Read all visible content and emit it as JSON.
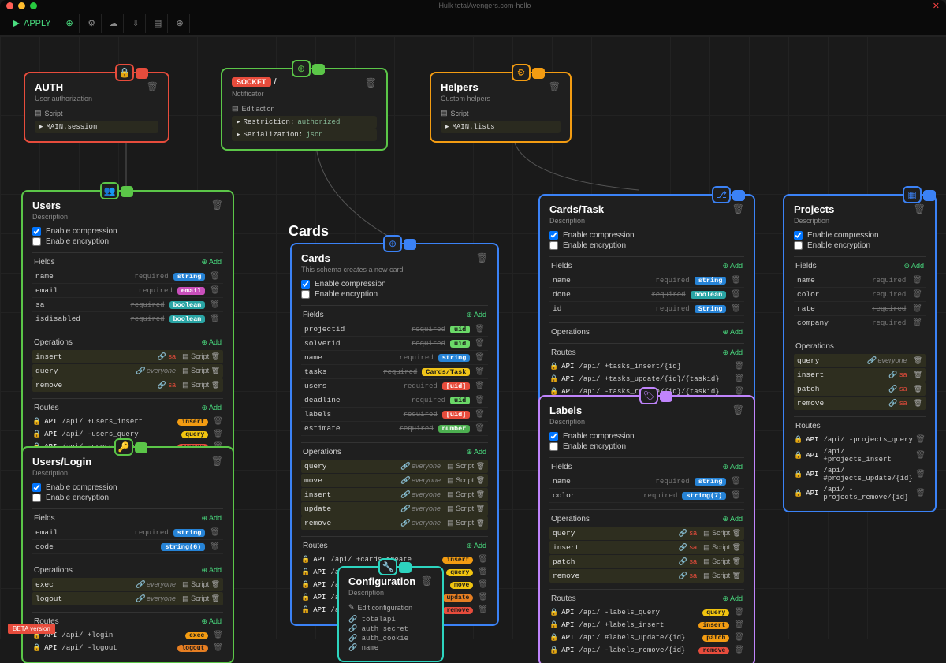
{
  "titlebar": {
    "title": "Hulk totalAvengers.com-hello"
  },
  "toolbar": {
    "apply": "APPLY"
  },
  "canvas_title": "Cards",
  "beta": "BETA version",
  "nodes": {
    "auth": {
      "title": "AUTH",
      "sub": "User authorization",
      "meta": "Script",
      "code": "MAIN.session"
    },
    "notificator": {
      "sub": "Notificator",
      "edit": "Edit action",
      "l1": "Restriction:",
      "l1v": "authorized",
      "l2": "Serialization:",
      "l2v": "json"
    },
    "helpers": {
      "title": "Helpers",
      "sub": "Custom helpers",
      "meta": "Script",
      "code": "MAIN.lists"
    },
    "users": {
      "title": "Users",
      "sub": "Description",
      "chk1": "Enable compression",
      "chk2": "Enable encryption",
      "fields_h": "Fields",
      "add": "Add",
      "fields": [
        {
          "n": "name",
          "r": "required",
          "t": "string"
        },
        {
          "n": "email",
          "r": "required",
          "t": "email"
        },
        {
          "n": "sa",
          "r": "required",
          "rs": true,
          "t": "boolean"
        },
        {
          "n": "isdisabled",
          "r": "required",
          "rs": true,
          "t": "boolean"
        }
      ],
      "ops_h": "Operations",
      "ops": [
        {
          "n": "insert",
          "m": "sa",
          "r": "Script"
        },
        {
          "n": "query",
          "m": "everyone",
          "r": "Script"
        },
        {
          "n": "remove",
          "m": "sa",
          "r": "Script"
        }
      ],
      "routes_h": "Routes",
      "routes": [
        {
          "p": "/api/ +users_insert",
          "pill": "insert"
        },
        {
          "p": "/api/ -users_query",
          "pill": "query"
        },
        {
          "p": "/api/ -users_remove",
          "pill": "remove"
        }
      ]
    },
    "users_login": {
      "title": "Users/Login",
      "sub": "Description",
      "chk1": "Enable compression",
      "chk2": "Enable encryption",
      "fields_h": "Fields",
      "add": "Add",
      "fields": [
        {
          "n": "email",
          "r": "required",
          "t": "string"
        },
        {
          "n": "code",
          "r": "",
          "t": "string(6)"
        }
      ],
      "ops_h": "Operations",
      "ops": [
        {
          "n": "exec",
          "m": "everyone",
          "r": "Script"
        },
        {
          "n": "logout",
          "m": "everyone",
          "r": "Script"
        }
      ],
      "routes_h": "Routes",
      "routes": [
        {
          "p": "/api/ +login",
          "pill": "exec"
        },
        {
          "p": "/api/ -logout",
          "pill": "logout"
        }
      ]
    },
    "cards": {
      "title": "Cards",
      "sub": "This schema creates a new card",
      "chk1": "Enable compression",
      "chk2": "Enable encryption",
      "fields_h": "Fields",
      "add": "Add",
      "fields": [
        {
          "n": "projectid",
          "r": "required",
          "rs": true,
          "t": "uid"
        },
        {
          "n": "solverid",
          "r": "required",
          "rs": true,
          "t": "uid"
        },
        {
          "n": "name",
          "r": "required",
          "t": "string"
        },
        {
          "n": "tasks",
          "r": "required",
          "rs": true,
          "t": "Cards/Task"
        },
        {
          "n": "users",
          "r": "required",
          "rs": true,
          "t": "[uid]"
        },
        {
          "n": "deadline",
          "r": "required",
          "rs": true,
          "t": "uid"
        },
        {
          "n": "labels",
          "r": "required",
          "rs": true,
          "t": "[uid]"
        },
        {
          "n": "estimate",
          "r": "required",
          "rs": true,
          "t": "number"
        }
      ],
      "ops_h": "Operations",
      "ops": [
        {
          "n": "query",
          "m": "everyone",
          "r": "Script"
        },
        {
          "n": "move",
          "m": "everyone",
          "r": "Script"
        },
        {
          "n": "insert",
          "m": "everyone",
          "r": "Script"
        },
        {
          "n": "update",
          "m": "everyone",
          "r": "Script"
        },
        {
          "n": "remove",
          "m": "everyone",
          "r": "Script"
        }
      ],
      "routes_h": "Routes",
      "routes": [
        {
          "p": "/api/ +cards_create",
          "pill": "insert"
        },
        {
          "p": "/api/ -cards_query",
          "pill": "query"
        },
        {
          "p": "/api/ -cards_move/{id}",
          "pill": "move"
        },
        {
          "p": "/api/ +cards_update/{id}",
          "pill": "update"
        },
        {
          "p": "/api/ -cards_remove/{id}",
          "pill": "remove"
        }
      ]
    },
    "config": {
      "title": "Configuration",
      "sub": "Description",
      "edit": "Edit configuration",
      "items": [
        "totalapi",
        "auth_secret",
        "auth_cookie",
        "name"
      ]
    },
    "cards_task": {
      "title": "Cards/Task",
      "sub": "Description",
      "chk1": "Enable compression",
      "chk2": "Enable encryption",
      "fields_h": "Fields",
      "add": "Add",
      "fields": [
        {
          "n": "name",
          "r": "required",
          "t": "string"
        },
        {
          "n": "done",
          "r": "required",
          "rs": true,
          "t": "boolean"
        },
        {
          "n": "id",
          "r": "required",
          "t": "String"
        }
      ],
      "ops_h": "Operations",
      "routes_h": "Routes",
      "routes": [
        {
          "p": "/api/ +tasks_insert/{id}"
        },
        {
          "p": "/api/ +tasks_update/{id}/{taskid}"
        },
        {
          "p": "/api/ -tasks_remove/{id}/{taskid}"
        }
      ]
    },
    "labels": {
      "title": "Labels",
      "sub": "Description",
      "chk1": "Enable compression",
      "chk2": "Enable encryption",
      "fields_h": "Fields",
      "add": "Add",
      "fields": [
        {
          "n": "name",
          "r": "required",
          "t": "string"
        },
        {
          "n": "color",
          "r": "required",
          "t": "string(7)"
        }
      ],
      "ops_h": "Operations",
      "ops": [
        {
          "n": "query",
          "m": "sa",
          "r": "Script"
        },
        {
          "n": "insert",
          "m": "sa",
          "r": "Script"
        },
        {
          "n": "patch",
          "m": "sa",
          "r": "Script"
        },
        {
          "n": "remove",
          "m": "sa",
          "r": "Script"
        }
      ],
      "routes_h": "Routes",
      "routes": [
        {
          "p": "/api/ -labels_query",
          "pill": "query"
        },
        {
          "p": "/api/ +labels_insert",
          "pill": "insert"
        },
        {
          "p": "/api/ #labels_update/{id}",
          "pill": "patch"
        },
        {
          "p": "/api/ -labels_remove/{id}",
          "pill": "remove"
        }
      ]
    },
    "projects": {
      "title": "Projects",
      "sub": "Description",
      "chk1": "Enable compression",
      "chk2": "Enable encryption",
      "fields_h": "Fields",
      "add": "Add",
      "fields": [
        {
          "n": "name",
          "r": "required"
        },
        {
          "n": "color",
          "r": "required"
        },
        {
          "n": "rate",
          "r": "required",
          "rs": true
        },
        {
          "n": "company",
          "r": "required"
        }
      ],
      "ops_h": "Operations",
      "ops": [
        {
          "n": "query",
          "m": "everyone"
        },
        {
          "n": "insert",
          "m": "sa"
        },
        {
          "n": "patch",
          "m": "sa"
        },
        {
          "n": "remove",
          "m": "sa"
        }
      ],
      "routes_h": "Routes",
      "routes": [
        {
          "p": "/api/ -projects_query"
        },
        {
          "p": "/api/ +projects_insert"
        },
        {
          "p": "/api/ #projects_update/{id}"
        },
        {
          "p": "/api/ -projects_remove/{id}"
        }
      ]
    }
  }
}
